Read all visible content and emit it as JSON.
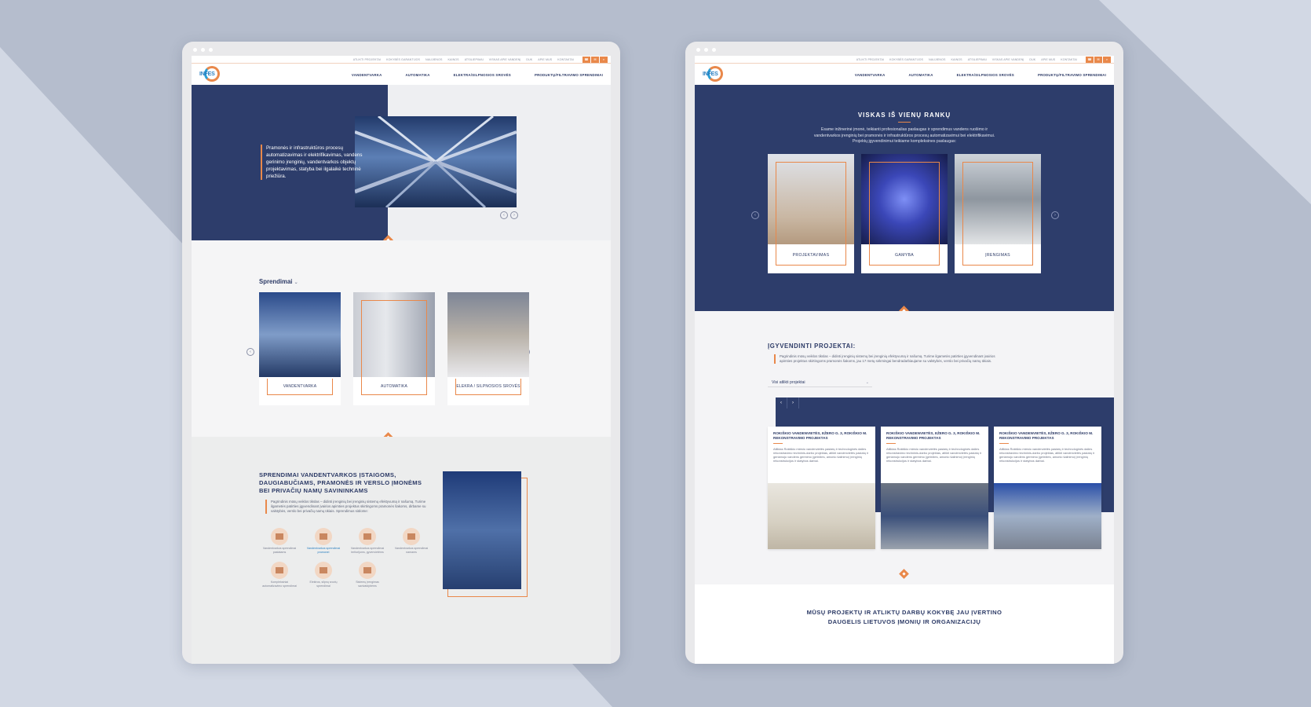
{
  "colors": {
    "navy": "#2d3d6b",
    "accent": "#e9884a",
    "background": "#c9d0de"
  },
  "logo": {
    "text": "INFES"
  },
  "topbar": {
    "links": [
      "ATLIKTI PROJEKTAI",
      "KOKYBĖS GARANTIJOS",
      "NAUJIENOS",
      "KAINOS",
      "ATSILIEPIMAI",
      "VISKAS APIE VANDENĮ",
      "DUK",
      "APIE MUS",
      "KONTAKTAI"
    ],
    "icons": [
      "phone-icon",
      "mail-icon",
      "search-icon"
    ]
  },
  "nav": {
    "items": [
      "VANDENTVARKA",
      "AUTOMATIKA",
      "ELEKTRA/SILPNOSIOS SROVĖS",
      "PRODUKTŲ/FILTRAVIMO SPRENDIMAI"
    ]
  },
  "left": {
    "hero_text": "Pramonės ir infrastruktūros procesų automatizavimas ir elektrifikavimas, vandens gerinimo įrenginių, vandentvarkos objektų projektavimas, statyba bei ilgalaikė techninė priežiūra.",
    "solutions_title": "Sprendimai",
    "solution_cards": [
      "VANDENTVARKA",
      "AUTOMATIKA",
      "ELEKRA / SILPNOSIOS SROVĖS"
    ],
    "dist_title": "SPRENDIMAI VANDENTVARKOS ĮSTAIGOMS, DAUGIABUČIAMS, PRAMONĖS IR VERSLO ĮMONĖMS BEI PRIVAČIŲ NAMŲ SAVININKAMS",
    "dist_text": "Pagrindinis mūsų veiklos tikslas – didinti įrenginių bei įrenginių sistemų efektyvumą ir našumą. Turime ilgametės patirties įgyvendinant įvairios apimties projektus skirtingoms pramonės šakoms, dirbame su valstybės, verslo bei privačių namų ūkiais. Sprendimus siūlome:",
    "dist_icons": [
      "Vandentvarkos sprendimai pastatams",
      "Vandentvarkos sprendimai pramonei",
      "Vandentvarkos sprendimai teritorijoms, gyvenvietėms",
      "Vandentvarkos sprendimai namams",
      "Kompleksiniai automatizavimo sprendimai",
      "Elektros, silpnų srovių sprendimai",
      "Sistemų įrengimas savivaldybėms"
    ]
  },
  "right": {
    "hero_title": "VISKAS IŠ VIENŲ RANKŲ",
    "hero_sub": "Esame inžinerinė įmonė, teikianti profesionalias paslaugas ir sprendimus vandens ruošimo ir vandentvarkos įrenginių bei pramonės ir infrastruktūros procesų automatizavimui bei elektrifikavimui. Projektų įgyvendinimui teikiame kompleksines paslaugas:",
    "services": [
      "PROJEKTAVIMAS",
      "GAMYBA",
      "ĮRENGIMAS"
    ],
    "projects_title": "ĮGYVENDINTI PROJEKTAI:",
    "projects_text": "Pagrindinis mūsų veiklos tikslas – didinti įrenginių sistemų bei įrenginių efektyvumą ir našumą. Turime ilgametės patirties įgyvendinant įvairios apimties projektus skirtingoms pramonės šakoms, jau 17 metų sėkmingai bendradarbiaujame su valstybės, verslo bei privačių namų ūkiais.",
    "projects_select": "Visi atlikti projektai",
    "project_cards": [
      {
        "title": "ROKIŠKIO VANDENVIETĖS, EŽERO G. 3, ROKIŠKIO M. REKONSTRAVIMO PROJEKTAS",
        "desc": "Atliktas Rokiškio miesto vandenvietės pastatų ir technologinės dalies rekonstravimo techninis-darbo projektas, atlikti vandenvietės pastatų ir geriamojo vandens gerinimo (geležies, amonio šalinimo) įrenginių rekonstrukcijos ir statybos darbai."
      },
      {
        "title": "ROKIŠKIO VANDENVIETĖS, EŽERO G. 3, ROKIŠKIO M. REKONSTRAVIMO PROJEKTAS",
        "desc": "Atliktas Rokiškio miesto vandenvietės pastatų ir technologinės dalies rekonstravimo techninis-darbo projektas, atlikti vandenvietės pastatų ir geriamojo vandens gerinimo (geležies, amonio šalinimo) įrenginių rekonstrukcijos ir statybos darbai."
      },
      {
        "title": "ROKIŠKIO VANDENVIETĖS, EŽERO G. 3, ROKIŠKIO M. REKONSTRAVIMO PROJEKTAS",
        "desc": "Atliktas Rokiškio miesto vandenvietės pastatų ir technologinės dalies rekonstravimo techninis-darbo projektas, atlikti vandenvietės pastatų ir geriamojo vandens gerinimo (geležies, amonio šalinimo) įrenginių rekonstrukcijos ir statybos darbai."
      }
    ],
    "bottom_title": "MŪSŲ PROJEKTŲ IR ATLIKTŲ DARBŲ KOKYBĘ JAU ĮVERTINO DAUGELIS LIETUVOS ĮMONIŲ IR ORGANIZACIJŲ"
  }
}
